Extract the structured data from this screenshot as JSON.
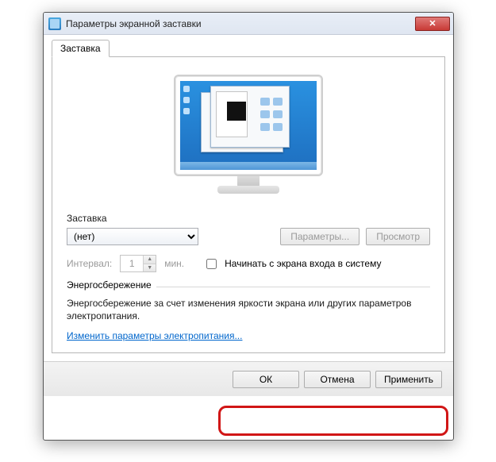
{
  "window": {
    "title": "Параметры экранной заставки"
  },
  "tab": {
    "label": "Заставка"
  },
  "screensaver": {
    "group_label": "Заставка",
    "selected": "(нет)",
    "settings_btn": "Параметры...",
    "preview_btn": "Просмотр",
    "wait_label": "Интервал:",
    "wait_value": "1",
    "wait_unit": "мин.",
    "resume_checkbox_label": "Начинать с экрана входа в систему"
  },
  "power": {
    "legend": "Энергосбережение",
    "text": "Энергосбережение за счет изменения яркости экрана или других параметров электропитания.",
    "link": "Изменить параметры электропитания..."
  },
  "buttons": {
    "ok": "ОК",
    "cancel": "Отмена",
    "apply": "Применить"
  }
}
